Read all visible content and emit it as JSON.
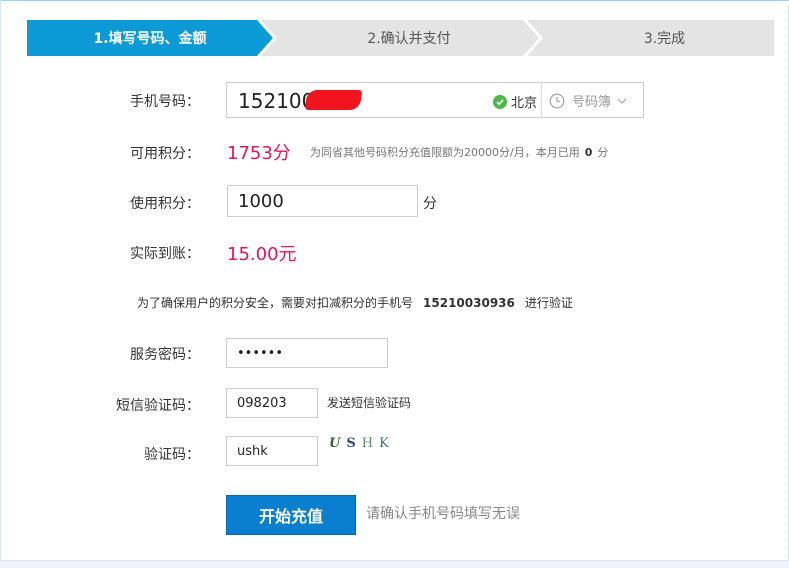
{
  "steps": [
    {
      "label": "1.填写号码、金额",
      "active": true
    },
    {
      "label": "2.确认并支付",
      "active": false
    },
    {
      "label": "3.完成",
      "active": false
    }
  ],
  "form": {
    "phone": {
      "label": "手机号码：",
      "value": "152100",
      "city": "北京",
      "phonebook_label": "号码簿"
    },
    "available_points": {
      "label": "可用积分：",
      "value": "1753分",
      "note_prefix": "为同省其他号码积分充值限额为20000分/月，本月已用",
      "note_used": "0",
      "note_suffix": "分"
    },
    "use_points": {
      "label": "使用积分：",
      "value": "1000",
      "unit": "分"
    },
    "actual_amount": {
      "label": "实际到账：",
      "value": "15.00元"
    },
    "verify_notice": {
      "prefix": "为了确保用户的积分安全，需要对扣减积分的手机号",
      "phone": "15210030936",
      "suffix": "进行验证"
    },
    "service_password": {
      "label": "服务密码：",
      "value": "••••••"
    },
    "sms_code": {
      "label": "短信验证码：",
      "value": "098203",
      "send_label": "发送短信验证码"
    },
    "captcha": {
      "label": "验证码：",
      "value": "ushk",
      "image_chars": [
        "U",
        "S",
        "H",
        "K"
      ]
    },
    "submit": {
      "label": "开始充值",
      "hint": "请确认手机号码填写无误"
    }
  },
  "colors": {
    "primary_blue": "#0b9ad6",
    "button_blue": "#0a7fcf",
    "highlight_pink": "#e2145f",
    "check_green": "#4cb848",
    "step_inactive": "#e4e4e4"
  },
  "icons": {
    "city_status": "check-circle-icon",
    "phonebook": "clock-icon",
    "phonebook_dropdown": "chevron-down-icon"
  }
}
